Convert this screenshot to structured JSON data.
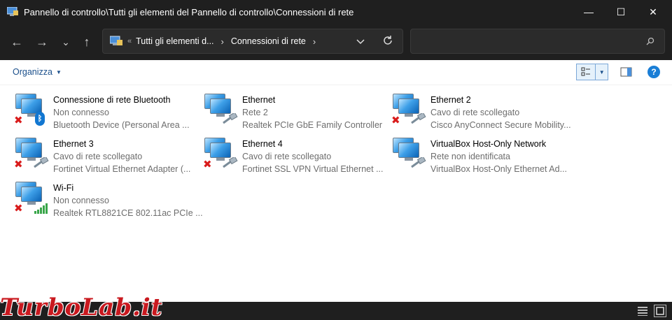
{
  "window": {
    "title": "Pannello di controllo\\Tutti gli elementi del Pannello di controllo\\Connessioni di rete",
    "minimize": "—",
    "maximize": "☐",
    "close": "✕"
  },
  "nav": {
    "back": "←",
    "forward": "→",
    "recent": "⌄",
    "up": "↑"
  },
  "address": {
    "overflow": "«",
    "crumbs": [
      "Tutti gli elementi d...",
      "Connessioni di rete"
    ],
    "chevron": "›"
  },
  "search": {
    "placeholder": ""
  },
  "commandbar": {
    "organize_label": "Organizza",
    "help_label": "?"
  },
  "items": [
    {
      "name": "Connessione di rete Bluetooth",
      "status": "Non connesso",
      "device": "Bluetooth Device (Personal Area ...",
      "badge": "bluetooth-icon",
      "disconnected": true
    },
    {
      "name": "Ethernet",
      "status": "Rete 2",
      "device": "Realtek PCIe GbE Family Controller",
      "badge": "ethernet-cable-icon",
      "disconnected": false
    },
    {
      "name": "Ethernet 2",
      "status": "Cavo di rete scollegato",
      "device": "Cisco AnyConnect Secure Mobility...",
      "badge": "ethernet-cable-icon",
      "disconnected": true
    },
    {
      "name": "Ethernet 3",
      "status": "Cavo di rete scollegato",
      "device": "Fortinet Virtual Ethernet Adapter (...",
      "badge": "ethernet-cable-icon",
      "disconnected": true
    },
    {
      "name": "Ethernet 4",
      "status": "Cavo di rete scollegato",
      "device": "Fortinet SSL VPN Virtual Ethernet ...",
      "badge": "ethernet-cable-icon",
      "disconnected": true
    },
    {
      "name": "VirtualBox Host-Only Network",
      "status": "Rete non identificata",
      "device": "VirtualBox Host-Only Ethernet Ad...",
      "badge": "ethernet-cable-icon",
      "disconnected": false
    },
    {
      "name": "Wi-Fi",
      "status": "Non connesso",
      "device": "Realtek RTL8821CE 802.11ac PCIe ...",
      "badge": "wifi-signal-icon",
      "disconnected": true
    }
  ],
  "watermark": "TurboLab.it",
  "colors": {
    "chrome_bg": "#1f1f1f",
    "content_bg": "#ffffff",
    "link_blue": "#1a4f8b",
    "error_red": "#d91c1c",
    "watermark_red": "#c9191f"
  }
}
